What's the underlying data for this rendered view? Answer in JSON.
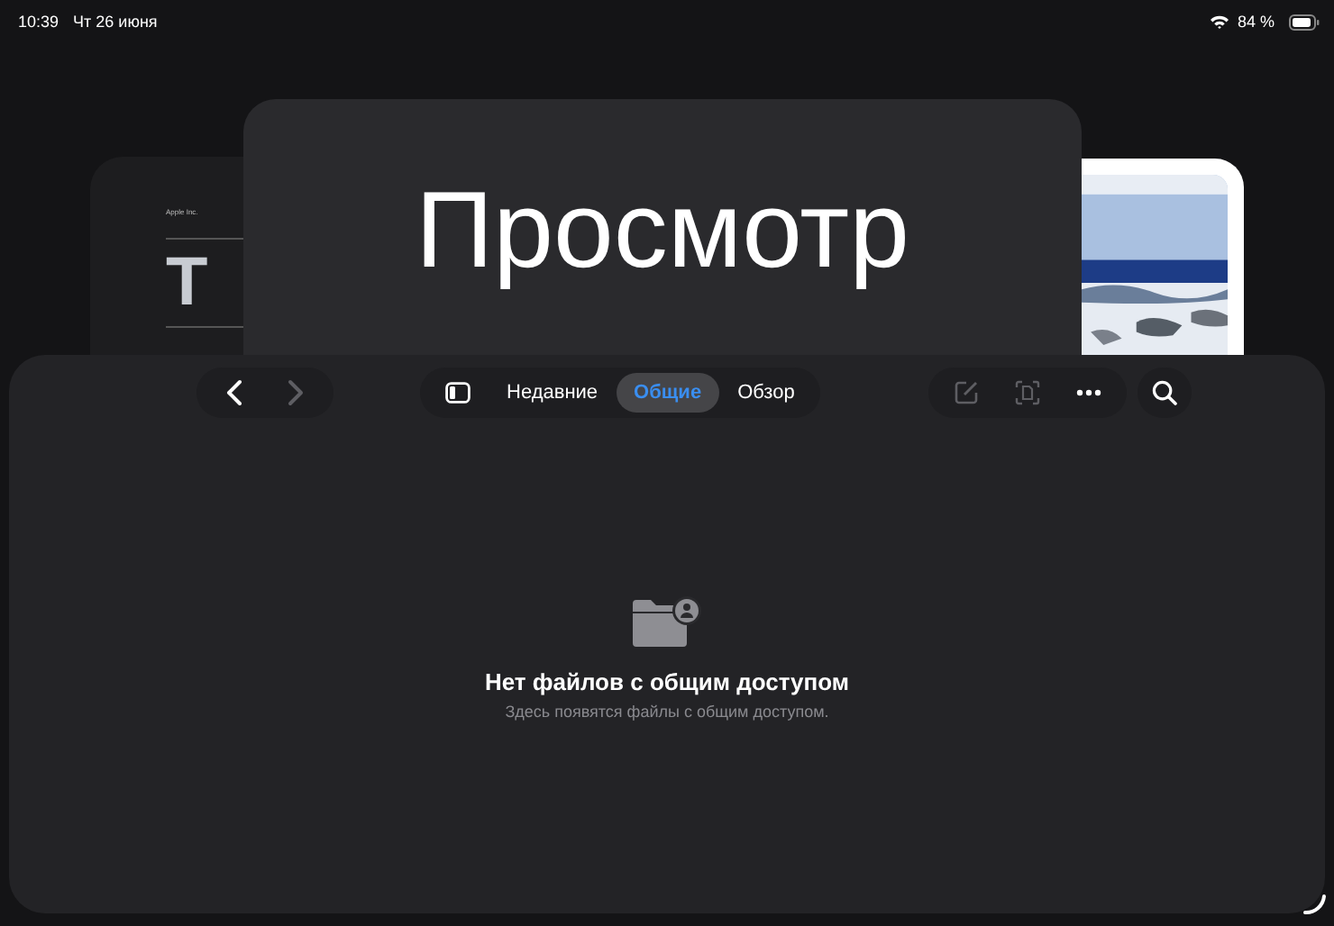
{
  "status_bar": {
    "time": "10:39",
    "date": "Чт 26 июня",
    "battery": "84 %"
  },
  "back_windows": [
    {
      "kind": "document",
      "company": "Apple Inc.",
      "heading": "T"
    },
    {
      "kind": "title",
      "title": "Просмотр"
    },
    {
      "kind": "picture"
    }
  ],
  "toolbar": {
    "back_disabled": false,
    "forward_disabled": true,
    "tabs": [
      {
        "label": "Недавние",
        "selected": false
      },
      {
        "label": "Общие",
        "selected": true
      },
      {
        "label": "Обзор",
        "selected": false
      }
    ],
    "edit_disabled": true,
    "scan_disabled": true
  },
  "empty_state": {
    "title": "Нет файлов с общим доступом",
    "subtitle": "Здесь появятся файлы с общим доступом."
  }
}
